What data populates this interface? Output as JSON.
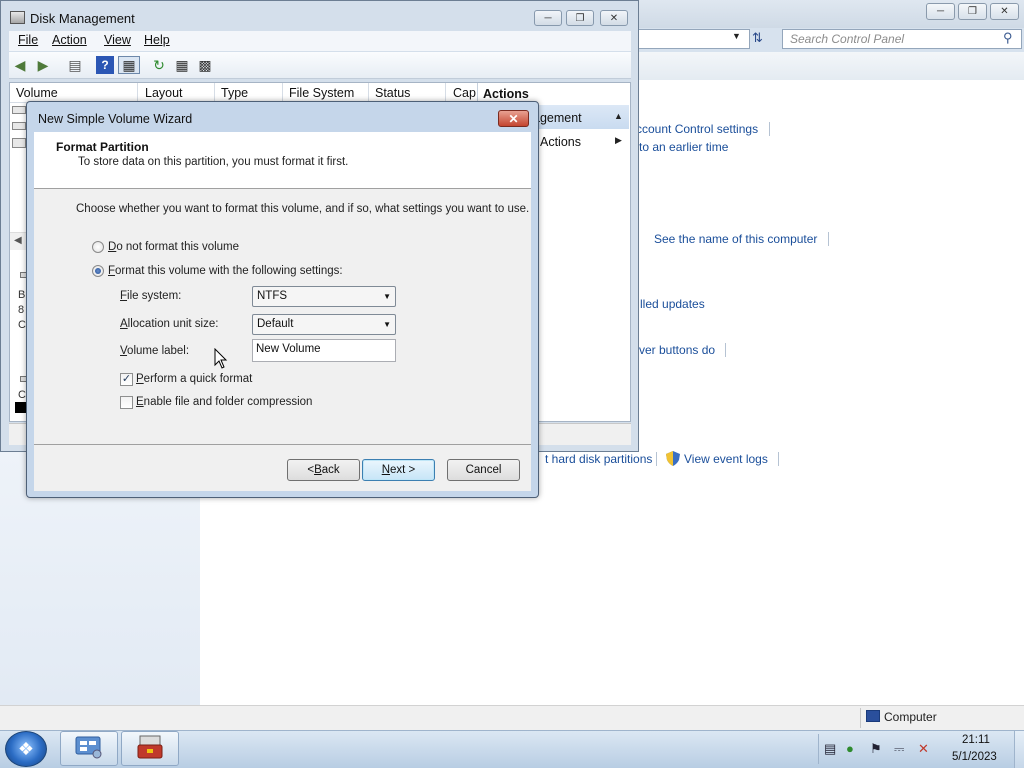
{
  "control_panel": {
    "search_placeholder": "Search Control Panel",
    "links": {
      "uac": "ccount Control settings",
      "restore": "to an earlier time",
      "computer_name": "See the name of this computer",
      "updates": "lled updates",
      "power": "ver buttons do",
      "partitions": "t hard disk partitions",
      "event_logs": "View event logs"
    },
    "status_location": "Computer"
  },
  "disk_management": {
    "title": "Disk Management",
    "menu": [
      "File",
      "Action",
      "View",
      "Help"
    ],
    "columns": [
      "Volume",
      "Layout",
      "Type",
      "File System",
      "Status",
      "Cap"
    ],
    "actions_header": "Actions",
    "actions_item": "agement",
    "more_actions": "Actions",
    "stub_letters": [
      "B",
      "8",
      "C",
      "C"
    ]
  },
  "wizard": {
    "title": "New Simple Volume Wizard",
    "header_title": "Format Partition",
    "header_subtitle": "To store data on this partition, you must format it first.",
    "instruction": "Choose whether you want to format this volume, and if so, what settings you want to use.",
    "option_no_format": {
      "mnemonic": "D",
      "rest": "o not format this volume",
      "selected": false
    },
    "option_format": {
      "mnemonic": "F",
      "rest": "ormat this volume with the following settings:",
      "selected": true
    },
    "file_system": {
      "mnemonic": "F",
      "rest": "ile system:",
      "value": "NTFS"
    },
    "allocation": {
      "mnemonic": "A",
      "rest": "llocation unit size:",
      "value": "Default"
    },
    "volume_label": {
      "mnemonic": "V",
      "rest": "olume label:",
      "value": "New Volume"
    },
    "quick_format": {
      "mnemonic": "P",
      "rest": "erform a quick format",
      "checked": true
    },
    "compression": {
      "mnemonic": "E",
      "rest": "nable file and folder compression",
      "checked": false
    },
    "buttons": {
      "back": {
        "prefix": "< ",
        "mnemonic": "B",
        "rest": "ack"
      },
      "next": {
        "mnemonic": "N",
        "rest": "ext >"
      },
      "cancel": "Cancel"
    }
  },
  "taskbar": {
    "time": "21:11",
    "date": "5/1/2023"
  },
  "icons": {
    "start": "windows-orb-icon",
    "tray": [
      "action-center-icon",
      "network-icon",
      "flag-icon",
      "power-icon",
      "volume-muted-icon"
    ]
  }
}
